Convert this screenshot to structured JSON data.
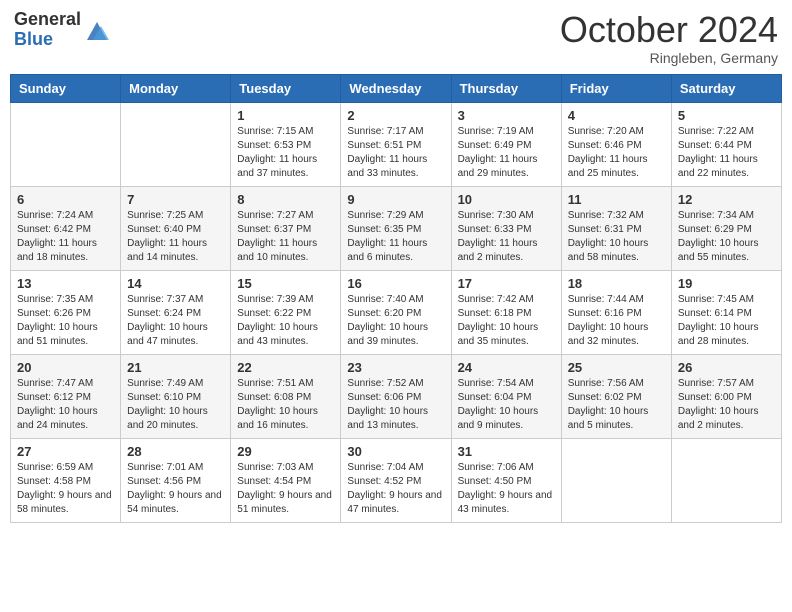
{
  "header": {
    "logo_general": "General",
    "logo_blue": "Blue",
    "month": "October 2024",
    "location": "Ringleben, Germany"
  },
  "days_of_week": [
    "Sunday",
    "Monday",
    "Tuesday",
    "Wednesday",
    "Thursday",
    "Friday",
    "Saturday"
  ],
  "weeks": [
    [
      {
        "day": "",
        "sunrise": "",
        "sunset": "",
        "daylight": ""
      },
      {
        "day": "",
        "sunrise": "",
        "sunset": "",
        "daylight": ""
      },
      {
        "day": "1",
        "sunrise": "Sunrise: 7:15 AM",
        "sunset": "Sunset: 6:53 PM",
        "daylight": "Daylight: 11 hours and 37 minutes."
      },
      {
        "day": "2",
        "sunrise": "Sunrise: 7:17 AM",
        "sunset": "Sunset: 6:51 PM",
        "daylight": "Daylight: 11 hours and 33 minutes."
      },
      {
        "day": "3",
        "sunrise": "Sunrise: 7:19 AM",
        "sunset": "Sunset: 6:49 PM",
        "daylight": "Daylight: 11 hours and 29 minutes."
      },
      {
        "day": "4",
        "sunrise": "Sunrise: 7:20 AM",
        "sunset": "Sunset: 6:46 PM",
        "daylight": "Daylight: 11 hours and 25 minutes."
      },
      {
        "day": "5",
        "sunrise": "Sunrise: 7:22 AM",
        "sunset": "Sunset: 6:44 PM",
        "daylight": "Daylight: 11 hours and 22 minutes."
      }
    ],
    [
      {
        "day": "6",
        "sunrise": "Sunrise: 7:24 AM",
        "sunset": "Sunset: 6:42 PM",
        "daylight": "Daylight: 11 hours and 18 minutes."
      },
      {
        "day": "7",
        "sunrise": "Sunrise: 7:25 AM",
        "sunset": "Sunset: 6:40 PM",
        "daylight": "Daylight: 11 hours and 14 minutes."
      },
      {
        "day": "8",
        "sunrise": "Sunrise: 7:27 AM",
        "sunset": "Sunset: 6:37 PM",
        "daylight": "Daylight: 11 hours and 10 minutes."
      },
      {
        "day": "9",
        "sunrise": "Sunrise: 7:29 AM",
        "sunset": "Sunset: 6:35 PM",
        "daylight": "Daylight: 11 hours and 6 minutes."
      },
      {
        "day": "10",
        "sunrise": "Sunrise: 7:30 AM",
        "sunset": "Sunset: 6:33 PM",
        "daylight": "Daylight: 11 hours and 2 minutes."
      },
      {
        "day": "11",
        "sunrise": "Sunrise: 7:32 AM",
        "sunset": "Sunset: 6:31 PM",
        "daylight": "Daylight: 10 hours and 58 minutes."
      },
      {
        "day": "12",
        "sunrise": "Sunrise: 7:34 AM",
        "sunset": "Sunset: 6:29 PM",
        "daylight": "Daylight: 10 hours and 55 minutes."
      }
    ],
    [
      {
        "day": "13",
        "sunrise": "Sunrise: 7:35 AM",
        "sunset": "Sunset: 6:26 PM",
        "daylight": "Daylight: 10 hours and 51 minutes."
      },
      {
        "day": "14",
        "sunrise": "Sunrise: 7:37 AM",
        "sunset": "Sunset: 6:24 PM",
        "daylight": "Daylight: 10 hours and 47 minutes."
      },
      {
        "day": "15",
        "sunrise": "Sunrise: 7:39 AM",
        "sunset": "Sunset: 6:22 PM",
        "daylight": "Daylight: 10 hours and 43 minutes."
      },
      {
        "day": "16",
        "sunrise": "Sunrise: 7:40 AM",
        "sunset": "Sunset: 6:20 PM",
        "daylight": "Daylight: 10 hours and 39 minutes."
      },
      {
        "day": "17",
        "sunrise": "Sunrise: 7:42 AM",
        "sunset": "Sunset: 6:18 PM",
        "daylight": "Daylight: 10 hours and 35 minutes."
      },
      {
        "day": "18",
        "sunrise": "Sunrise: 7:44 AM",
        "sunset": "Sunset: 6:16 PM",
        "daylight": "Daylight: 10 hours and 32 minutes."
      },
      {
        "day": "19",
        "sunrise": "Sunrise: 7:45 AM",
        "sunset": "Sunset: 6:14 PM",
        "daylight": "Daylight: 10 hours and 28 minutes."
      }
    ],
    [
      {
        "day": "20",
        "sunrise": "Sunrise: 7:47 AM",
        "sunset": "Sunset: 6:12 PM",
        "daylight": "Daylight: 10 hours and 24 minutes."
      },
      {
        "day": "21",
        "sunrise": "Sunrise: 7:49 AM",
        "sunset": "Sunset: 6:10 PM",
        "daylight": "Daylight: 10 hours and 20 minutes."
      },
      {
        "day": "22",
        "sunrise": "Sunrise: 7:51 AM",
        "sunset": "Sunset: 6:08 PM",
        "daylight": "Daylight: 10 hours and 16 minutes."
      },
      {
        "day": "23",
        "sunrise": "Sunrise: 7:52 AM",
        "sunset": "Sunset: 6:06 PM",
        "daylight": "Daylight: 10 hours and 13 minutes."
      },
      {
        "day": "24",
        "sunrise": "Sunrise: 7:54 AM",
        "sunset": "Sunset: 6:04 PM",
        "daylight": "Daylight: 10 hours and 9 minutes."
      },
      {
        "day": "25",
        "sunrise": "Sunrise: 7:56 AM",
        "sunset": "Sunset: 6:02 PM",
        "daylight": "Daylight: 10 hours and 5 minutes."
      },
      {
        "day": "26",
        "sunrise": "Sunrise: 7:57 AM",
        "sunset": "Sunset: 6:00 PM",
        "daylight": "Daylight: 10 hours and 2 minutes."
      }
    ],
    [
      {
        "day": "27",
        "sunrise": "Sunrise: 6:59 AM",
        "sunset": "Sunset: 4:58 PM",
        "daylight": "Daylight: 9 hours and 58 minutes."
      },
      {
        "day": "28",
        "sunrise": "Sunrise: 7:01 AM",
        "sunset": "Sunset: 4:56 PM",
        "daylight": "Daylight: 9 hours and 54 minutes."
      },
      {
        "day": "29",
        "sunrise": "Sunrise: 7:03 AM",
        "sunset": "Sunset: 4:54 PM",
        "daylight": "Daylight: 9 hours and 51 minutes."
      },
      {
        "day": "30",
        "sunrise": "Sunrise: 7:04 AM",
        "sunset": "Sunset: 4:52 PM",
        "daylight": "Daylight: 9 hours and 47 minutes."
      },
      {
        "day": "31",
        "sunrise": "Sunrise: 7:06 AM",
        "sunset": "Sunset: 4:50 PM",
        "daylight": "Daylight: 9 hours and 43 minutes."
      },
      {
        "day": "",
        "sunrise": "",
        "sunset": "",
        "daylight": ""
      },
      {
        "day": "",
        "sunrise": "",
        "sunset": "",
        "daylight": ""
      }
    ]
  ]
}
